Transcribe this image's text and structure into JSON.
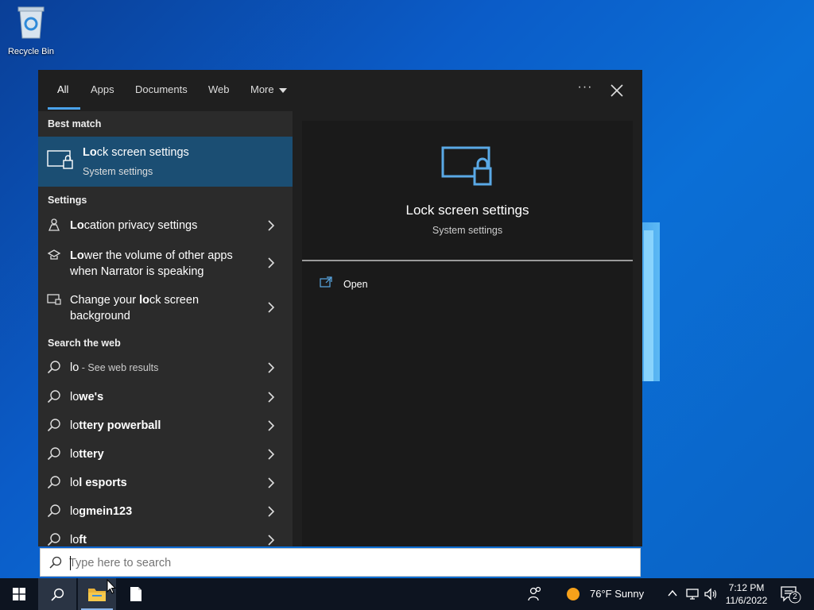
{
  "desktop": {
    "recycle_bin_label": "Recycle Bin"
  },
  "tabs": [
    {
      "label": "All",
      "active": true
    },
    {
      "label": "Apps"
    },
    {
      "label": "Documents"
    },
    {
      "label": "Web"
    },
    {
      "label": "More"
    }
  ],
  "toolbar": {
    "more_options_icon": "ellipsis-icon",
    "close_icon": "close-icon"
  },
  "best_match": {
    "section_label": "Best match",
    "title_bold": "Lo",
    "title_rest": "ck screen settings",
    "subtitle": "System settings"
  },
  "settings": {
    "section_label": "Settings",
    "items": [
      {
        "bold": "Lo",
        "rest": "cation privacy settings",
        "line2": ""
      },
      {
        "bold": "Lo",
        "rest": "wer the volume of other apps",
        "line2": "when Narrator is speaking"
      },
      {
        "pre": "Change your ",
        "bold": "lo",
        "rest": "ck screen",
        "line2": "background"
      }
    ]
  },
  "web": {
    "section_label": "Search the web",
    "items": [
      {
        "bold": "lo",
        "rest": "",
        "sub": " - See web results"
      },
      {
        "bold": "",
        "pre": "lo",
        "rest": "we's"
      },
      {
        "pre": "lo",
        "rest": "ttery powerball"
      },
      {
        "pre": "lo",
        "rest": "ttery"
      },
      {
        "pre": "lo",
        "rest": "l esports"
      },
      {
        "pre": "lo",
        "rest": "gmein123"
      },
      {
        "pre": "lo",
        "rest": "ft"
      }
    ]
  },
  "preview": {
    "title": "Lock screen settings",
    "subtitle": "System settings",
    "open_label": "Open"
  },
  "search": {
    "placeholder": "Type here to search",
    "value": ""
  },
  "taskbar": {
    "weather": "76°F  Sunny",
    "time": "7:12 PM",
    "date": "11/6/2022",
    "notification_count": "2"
  },
  "colors": {
    "accent": "#4aa2ea",
    "selected": "#1b4e73",
    "icon_blue": "#5aa9e6"
  }
}
